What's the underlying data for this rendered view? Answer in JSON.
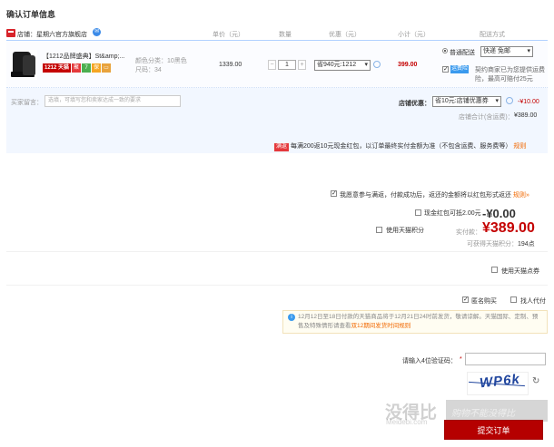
{
  "page": {
    "title": "确认订单信息"
  },
  "shop": {
    "label": "店铺：",
    "name": "星期六官方旗舰店"
  },
  "columns": [
    "单价（元）",
    "数量",
    "优惠（元）",
    "小计（元）",
    "配送方式"
  ],
  "item": {
    "title": "【1212品牌盛典】St&amp;...",
    "badge_1212": "1212 天猫",
    "badges": [
      {
        "text": "聚",
        "color": "#e4393c"
      },
      {
        "text": "7",
        "color": "#4caf50"
      },
      {
        "text": "保",
        "color": "#f5a623"
      },
      {
        "text": "▭",
        "color": "#e8a33d"
      }
    ],
    "color_label": "颜色分类：",
    "color_value": "10黑色",
    "size_label": "尺码：",
    "size_value": "34",
    "unit_price": "1339.00",
    "quantity": "1",
    "qty_minus": "−",
    "qty_plus": "+",
    "discount_option": "省940元:1212",
    "subtotal": "399.00"
  },
  "shipping": {
    "method_label": "普通配送",
    "method_value": "快递 免邮",
    "insurance_badge": "运费险",
    "insurance_text": "契约商家已为您提供运费险，最高可赔付25元"
  },
  "message": {
    "label": "买家留言：",
    "placeholder": "选填，可填写您和卖家达成一致的要求"
  },
  "store_discount": {
    "label": "店铺优惠：",
    "option": "省10元:店铺优惠券",
    "amount": "-¥10.00",
    "total_label": "店铺合计(含运费)：",
    "total_value": "¥389.00"
  },
  "promo": {
    "tag": "满返",
    "text": "每满200返10元现金红包，以订单最终实付金额为准（不包含运费、服务费等）",
    "rule": "规则"
  },
  "agree": {
    "text": "我愿意参与满返，付款成功后，返还的金额将以红包形式返还",
    "rule": "规则»"
  },
  "redpack": {
    "label": "现金红包可抵2.00元",
    "amount": "-¥0.00"
  },
  "tmall_points": {
    "label": "使用天猫积分"
  },
  "payment": {
    "label": "实付款：",
    "amount": "¥389.00",
    "earn_label": "可获得天猫积分：",
    "earn_value": "194点"
  },
  "points_coupon": {
    "label": "使用天猫点券"
  },
  "anonymous": {
    "label": "匿名购买"
  },
  "proxy_pay": {
    "label": "找人代付"
  },
  "notice": {
    "text": "12月12日至18日付款的天猫商品将于12月21日24时前发货，敬请谅解。天猫国际、定制、预售及特殊情形请查看",
    "link": "双12期间发货时间规则"
  },
  "captcha": {
    "label": "请输入4位验证码：",
    "star": "*",
    "code": "WP6k",
    "refresh": "↻"
  },
  "watermark": {
    "main": "没得比",
    "sub": "Meidebi.com",
    "band": "购物不能没得比"
  },
  "submit": {
    "label": "提交订单"
  },
  "colors": {
    "brand_red": "#c40000",
    "accent_blue": "#3a9aee",
    "link_orange": "#f16800"
  },
  "icons": [
    "shop-icon",
    "wangwang-icon",
    "tag-icon",
    "info-icon",
    "refresh-icon"
  ]
}
